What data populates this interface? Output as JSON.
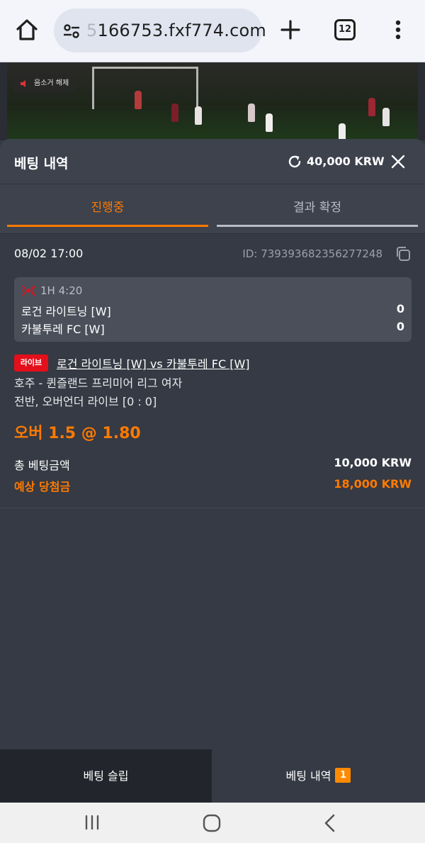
{
  "browser": {
    "url_faded": "5",
    "url_main": "166753.fxf774.com",
    "tab_count": "12",
    "home_icon": "home-icon",
    "site_settings_icon": "tune-icon",
    "new_tab_icon": "plus-icon",
    "menu_icon": "more-vert-icon"
  },
  "video": {
    "mute_label": "음소거 해제"
  },
  "panel": {
    "title": "베팅 내역",
    "balance": "40,000 KRW",
    "tabs": [
      {
        "label": "진행중",
        "active": true
      },
      {
        "label": "결과 확정",
        "active": false
      }
    ]
  },
  "bet": {
    "date": "08/02 17:00",
    "id": "ID: 739393682356277248",
    "match_time": "1H 4:20",
    "home_team": "로건 라이트닝 [W]",
    "home_score": "0",
    "away_team": "카불투레 FC [W]",
    "away_score": "0",
    "live_label": "라이브",
    "event": "로건 라이트닝 [W] vs 카불투레 FC [W]",
    "league": "호주 - 퀸즐랜드 프리미어 리그 여자",
    "market": "전반, 오버언더 라이브 [0 : 0]",
    "pick": "오버 1.5 @ 1.80",
    "stake_label": "총 베팅금액",
    "stake_value": "10,000 KRW",
    "payout_label": "예상 당첨금",
    "payout_value": "18,000 KRW"
  },
  "bottom": {
    "slip_label": "베팅 슬립",
    "history_label": "베팅 내역",
    "history_count": "1"
  },
  "colors": {
    "accent": "#ff7a00",
    "live_red": "#e3101b",
    "panel_bg": "#353a44"
  }
}
